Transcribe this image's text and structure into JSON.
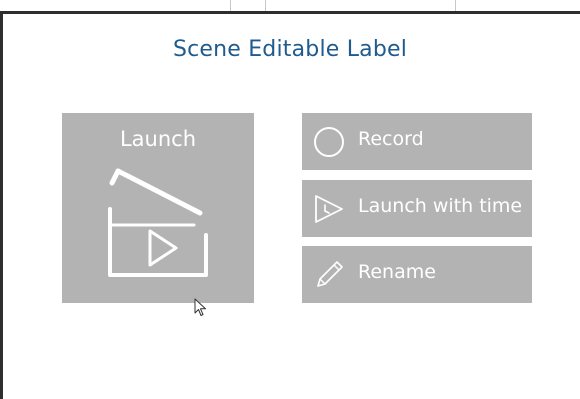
{
  "window": {
    "title": "Scene Editable Label"
  },
  "launch_tile": {
    "label": "Launch",
    "icon": "clapperboard-play-icon"
  },
  "actions": [
    {
      "label": "Record",
      "icon": "circle-record-icon"
    },
    {
      "label": "Launch with time",
      "icon": "timed-play-icon"
    },
    {
      "label": "Rename",
      "icon": "pencil-icon"
    }
  ],
  "colors": {
    "title": "#1f5b8e",
    "tile_background": "#b3b3b3",
    "tile_foreground": "#ffffff",
    "border": "#2e2e2e"
  }
}
